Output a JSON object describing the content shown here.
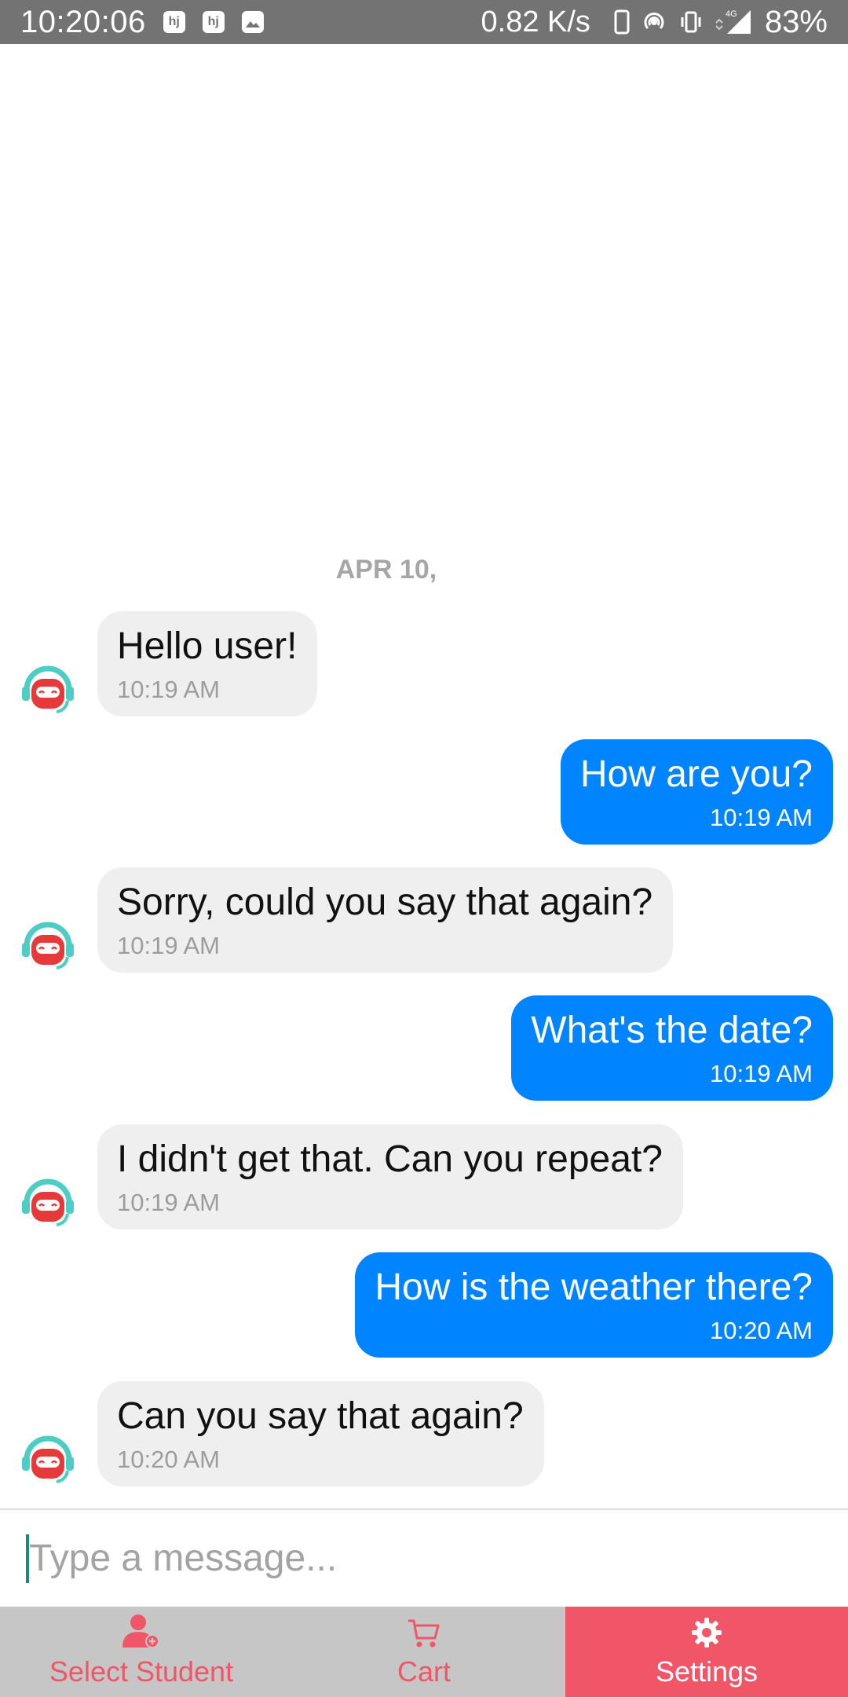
{
  "status_bar": {
    "time": "10:20:06",
    "notif_1": "hj",
    "notif_2": "hj",
    "net_speed": "0.82 K/s",
    "network_type": "4G",
    "battery": "83%"
  },
  "chat": {
    "date_separator": "APR 10,",
    "messages": [
      {
        "sender": "bot",
        "text": "Hello user!",
        "time": "10:19 AM"
      },
      {
        "sender": "user",
        "text": "How are you?",
        "time": "10:19 AM"
      },
      {
        "sender": "bot",
        "text": "Sorry, could you say that again?",
        "time": "10:19 AM"
      },
      {
        "sender": "user",
        "text": "What's the date?",
        "time": "10:19 AM"
      },
      {
        "sender": "bot",
        "text": "I didn't get that. Can you repeat?",
        "time": "10:19 AM"
      },
      {
        "sender": "user",
        "text": "How is the weather there?",
        "time": "10:20 AM"
      },
      {
        "sender": "bot",
        "text": "Can you say that again?",
        "time": "10:20 AM"
      }
    ]
  },
  "composer": {
    "placeholder": "Type a message..."
  },
  "bottom_nav": {
    "items": [
      {
        "label": "Select Student",
        "icon": "add-user-icon",
        "active": false
      },
      {
        "label": "Cart",
        "icon": "cart-icon",
        "active": false
      },
      {
        "label": "Settings",
        "icon": "gear-icon",
        "active": true
      }
    ]
  },
  "colors": {
    "status_bar": "#737373",
    "user_bubble": "#0084ff",
    "bot_bubble": "#efefef",
    "accent": "#f05668",
    "nav_background": "#c6c6c6"
  }
}
